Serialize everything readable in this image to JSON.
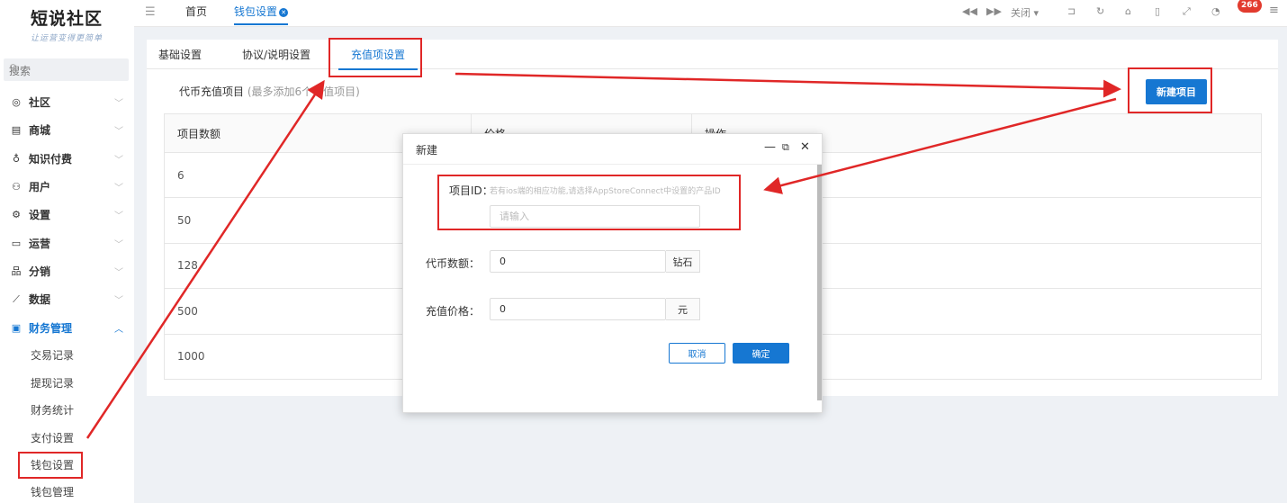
{
  "brand": {
    "name": "短说社区",
    "tagline": "让运营变得更简单"
  },
  "sidebar": {
    "search_label": "搜索",
    "menu": [
      {
        "icon": "chat-icon",
        "glyph": "◎",
        "label": "社区"
      },
      {
        "icon": "store-icon",
        "glyph": "▤",
        "label": "商城"
      },
      {
        "icon": "location-icon",
        "glyph": "♁",
        "label": "知识付费"
      },
      {
        "icon": "users-icon",
        "glyph": "⚇",
        "label": "用户"
      },
      {
        "icon": "gear-icon",
        "glyph": "⚙",
        "label": "设置"
      },
      {
        "icon": "monitor-icon",
        "glyph": "▭",
        "label": "运营"
      },
      {
        "icon": "network-icon",
        "glyph": "品",
        "label": "分销"
      },
      {
        "icon": "chart-icon",
        "glyph": "⟋",
        "label": "数据"
      },
      {
        "icon": "finance-icon",
        "glyph": "▣",
        "label": "财务管理"
      }
    ],
    "submenu": [
      "交易记录",
      "提现记录",
      "财务统计",
      "支付设置",
      "钱包设置",
      "钱包管理"
    ]
  },
  "topbar": {
    "tabs": [
      {
        "label": "首页"
      },
      {
        "label": "钱包设置"
      }
    ],
    "close_label": "关闭",
    "badge": "266",
    "icons": [
      "rewind-icon",
      "forward-icon",
      "close-dropdown",
      "exit-icon",
      "refresh-icon",
      "home-icon",
      "phone-icon",
      "fullscreen-icon",
      "bell-icon",
      "menu-icon"
    ]
  },
  "content": {
    "tabs": [
      "基础设置",
      "协议/说明设置",
      "充值项设置"
    ],
    "desc_title": "代币充值项目",
    "desc_hint": "(最多添加6个充值项目)",
    "new_button": "新建项目",
    "table": {
      "headers": [
        "项目数额",
        "价格",
        "操作"
      ],
      "rows": [
        "6",
        "50",
        "128",
        "500",
        "1000"
      ]
    }
  },
  "modal": {
    "title": "新建",
    "fields": {
      "id_label": "项目ID：",
      "id_hint": "若有ios端的相应功能,请选择AppStoreConnect中设置的产品ID",
      "id_placeholder": "请输入",
      "coins_label": "代币数额：",
      "coins_value": "0",
      "coins_suffix": "钻石",
      "price_label": "充值价格：",
      "price_value": "0",
      "price_suffix": "元"
    },
    "cancel": "取消",
    "confirm": "确定"
  },
  "colors": {
    "primary": "#1677d2",
    "annotation": "#e02727",
    "background": "#eef1f5"
  }
}
